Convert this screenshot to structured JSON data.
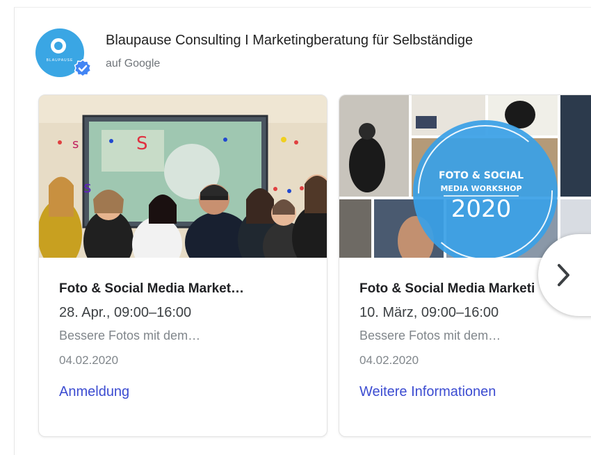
{
  "business": {
    "name": "Blaupause Consulting I Marketingberatung für Selbständige",
    "source": "auf Google",
    "logo_text": "BLAUPAUSE",
    "brand_color": "#3aa6e4",
    "verified_icon": "verified-check-icon"
  },
  "events": [
    {
      "title": "Foto & Social Media Market…",
      "date": "28. Apr., 09:00–16:00",
      "description": "Bessere Fotos mit dem…",
      "posted": "04.02.2020",
      "action": "Anmeldung"
    },
    {
      "title": "Foto & Social Media Marketi",
      "date": "10. März, 09:00–16:00",
      "description": "Bessere Fotos mit dem…",
      "posted": "04.02.2020",
      "action": "Weitere Informationen",
      "image_text_line1": "FOTO & SOCIAL",
      "image_text_line2": "MEDIA WORKSHOP",
      "image_text_year": "2020"
    }
  ],
  "colors": {
    "link": "#3c4cd1",
    "title": "#202124",
    "muted": "#80868b"
  },
  "carousel": {
    "next_icon": "chevron-right-icon"
  }
}
